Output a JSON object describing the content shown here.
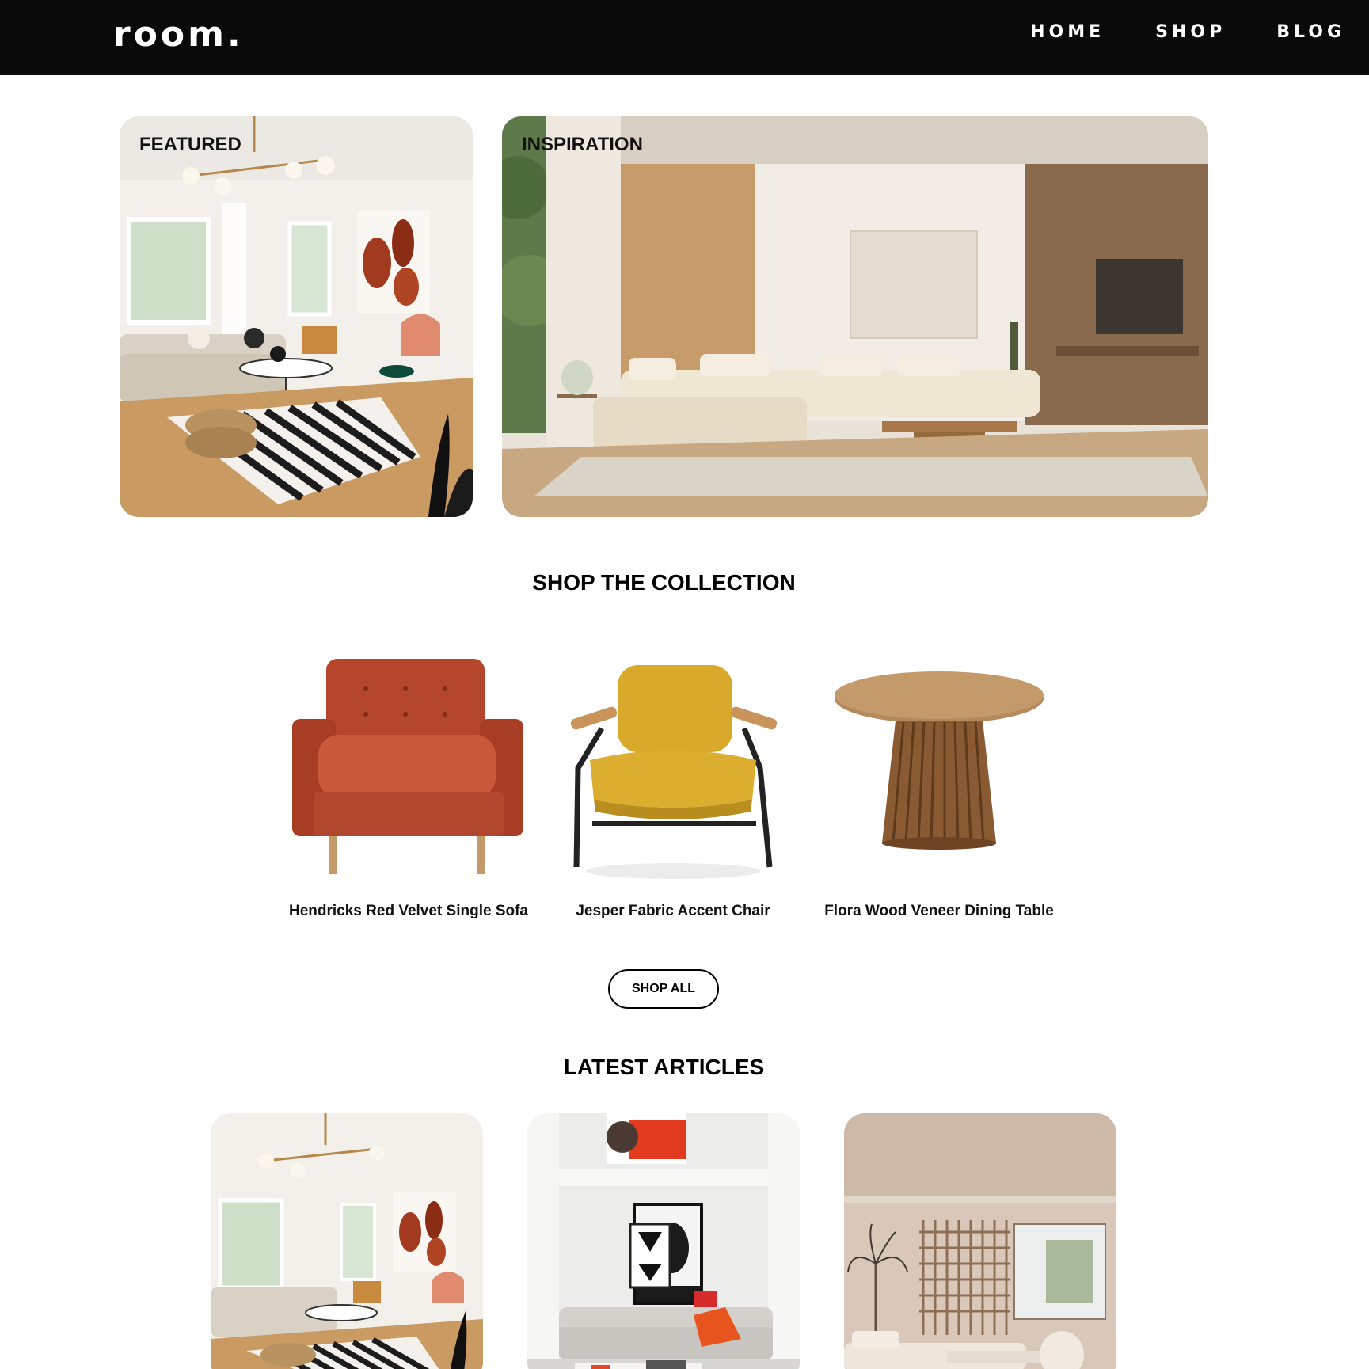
{
  "header": {
    "logo": "room.",
    "nav": [
      "HOME",
      "SHOP",
      "BLOG"
    ]
  },
  "hero": {
    "featured_label": "FEATURED",
    "inspiration_label": "INSPIRATION"
  },
  "collection": {
    "title": "SHOP THE COLLECTION",
    "products": [
      {
        "name": "Hendricks Red Velvet Single Sofa"
      },
      {
        "name": "Jesper Fabric Accent Chair"
      },
      {
        "name": "Flora Wood Veneer Dining Table"
      }
    ],
    "shop_all_label": "SHOP ALL"
  },
  "articles": {
    "title": "LATEST ARTICLES"
  },
  "colors": {
    "header_bg": "#0a0a0a",
    "sofa_red": "#b4462b",
    "chair_mustard": "#d9a92b",
    "wood": "#a87848"
  }
}
